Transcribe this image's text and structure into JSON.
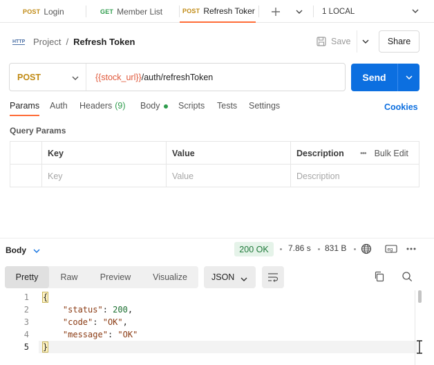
{
  "tabs": [
    {
      "method": "POST",
      "name": "Login"
    },
    {
      "method": "GET",
      "name": "Member List"
    },
    {
      "method": "POST",
      "name": "Refresh Toker"
    }
  ],
  "environment": "1 LOCAL",
  "breadcrumb": {
    "project": "Project",
    "separator": "/",
    "request": "Refresh Token"
  },
  "header": {
    "save_label": "Save",
    "share_label": "Share"
  },
  "request": {
    "method": "POST",
    "url_variable": "{{stock_url}}",
    "url_path": "/auth/refreshToken",
    "send_label": "Send"
  },
  "request_tabs": {
    "params": "Params",
    "auth": "Auth",
    "headers": "Headers",
    "headers_count": "(9)",
    "body": "Body",
    "scripts": "Scripts",
    "tests": "Tests",
    "settings": "Settings",
    "cookies": "Cookies"
  },
  "query_params": {
    "title": "Query Params",
    "columns": [
      "Key",
      "Value",
      "Description"
    ],
    "bulk_edit": "Bulk Edit",
    "placeholders": [
      "Key",
      "Value",
      "Description"
    ]
  },
  "response": {
    "section_label": "Body",
    "status": "200 OK",
    "time": "7.86 s",
    "size": "831 B",
    "views": [
      "Pretty",
      "Raw",
      "Preview",
      "Visualize"
    ],
    "active_view": "Pretty",
    "format": "JSON",
    "line_numbers": [
      "1",
      "2",
      "3",
      "4",
      "5"
    ],
    "lines": [
      {
        "open": "{"
      },
      {
        "key": "\"status\"",
        "sep": ": ",
        "num": "200",
        "end": ","
      },
      {
        "key": "\"code\"",
        "sep": ": ",
        "str": "\"OK\"",
        "end": ","
      },
      {
        "key": "\"message\"",
        "sep": ": ",
        "str": "\"OK\"",
        "end": ""
      },
      {
        "close": "}"
      }
    ]
  },
  "colors": {
    "accent": "#ff6c37",
    "send": "#0c6fe0",
    "post": "#c08a13",
    "get": "#2e9c4c",
    "status_ok_bg": "#e5f3e9",
    "status_ok_text": "#1f7a3a"
  }
}
